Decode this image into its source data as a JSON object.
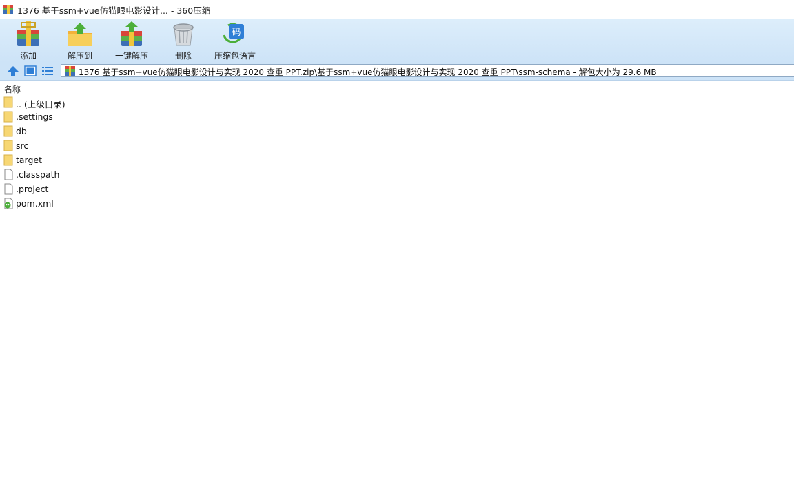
{
  "window": {
    "title": "1376 基于ssm+vue仿猫眼电影设计... - 360压缩"
  },
  "toolbar": {
    "buttons": [
      {
        "label": "添加",
        "icon": "add-archive-icon"
      },
      {
        "label": "解压到",
        "icon": "extract-to-icon"
      },
      {
        "label": "一键解压",
        "icon": "one-click-extract-icon"
      },
      {
        "label": "删除",
        "icon": "delete-icon"
      },
      {
        "label": "压缩包语言",
        "icon": "archive-language-icon"
      }
    ],
    "language_glyph": "码"
  },
  "nav": {
    "path": "1376 基于ssm+vue仿猫眼电影设计与实现  2020 查重 PPT.zip\\基于ssm+vue仿猫眼电影设计与实现  2020 查重 PPT\\ssm-schema - 解包大小为 29.6 MB"
  },
  "list": {
    "header_name": "名称",
    "items": [
      {
        "name": ".. (上级目录)",
        "type": "folder"
      },
      {
        "name": ".settings",
        "type": "folder"
      },
      {
        "name": "db",
        "type": "folder"
      },
      {
        "name": "src",
        "type": "folder"
      },
      {
        "name": "target",
        "type": "folder"
      },
      {
        "name": ".classpath",
        "type": "file"
      },
      {
        "name": ".project",
        "type": "file"
      },
      {
        "name": "pom.xml",
        "type": "xml"
      }
    ]
  },
  "colors": {
    "toolbar_bg": "#cde3f7",
    "folder": "#f7d774",
    "accent": "#2f7fd6"
  }
}
